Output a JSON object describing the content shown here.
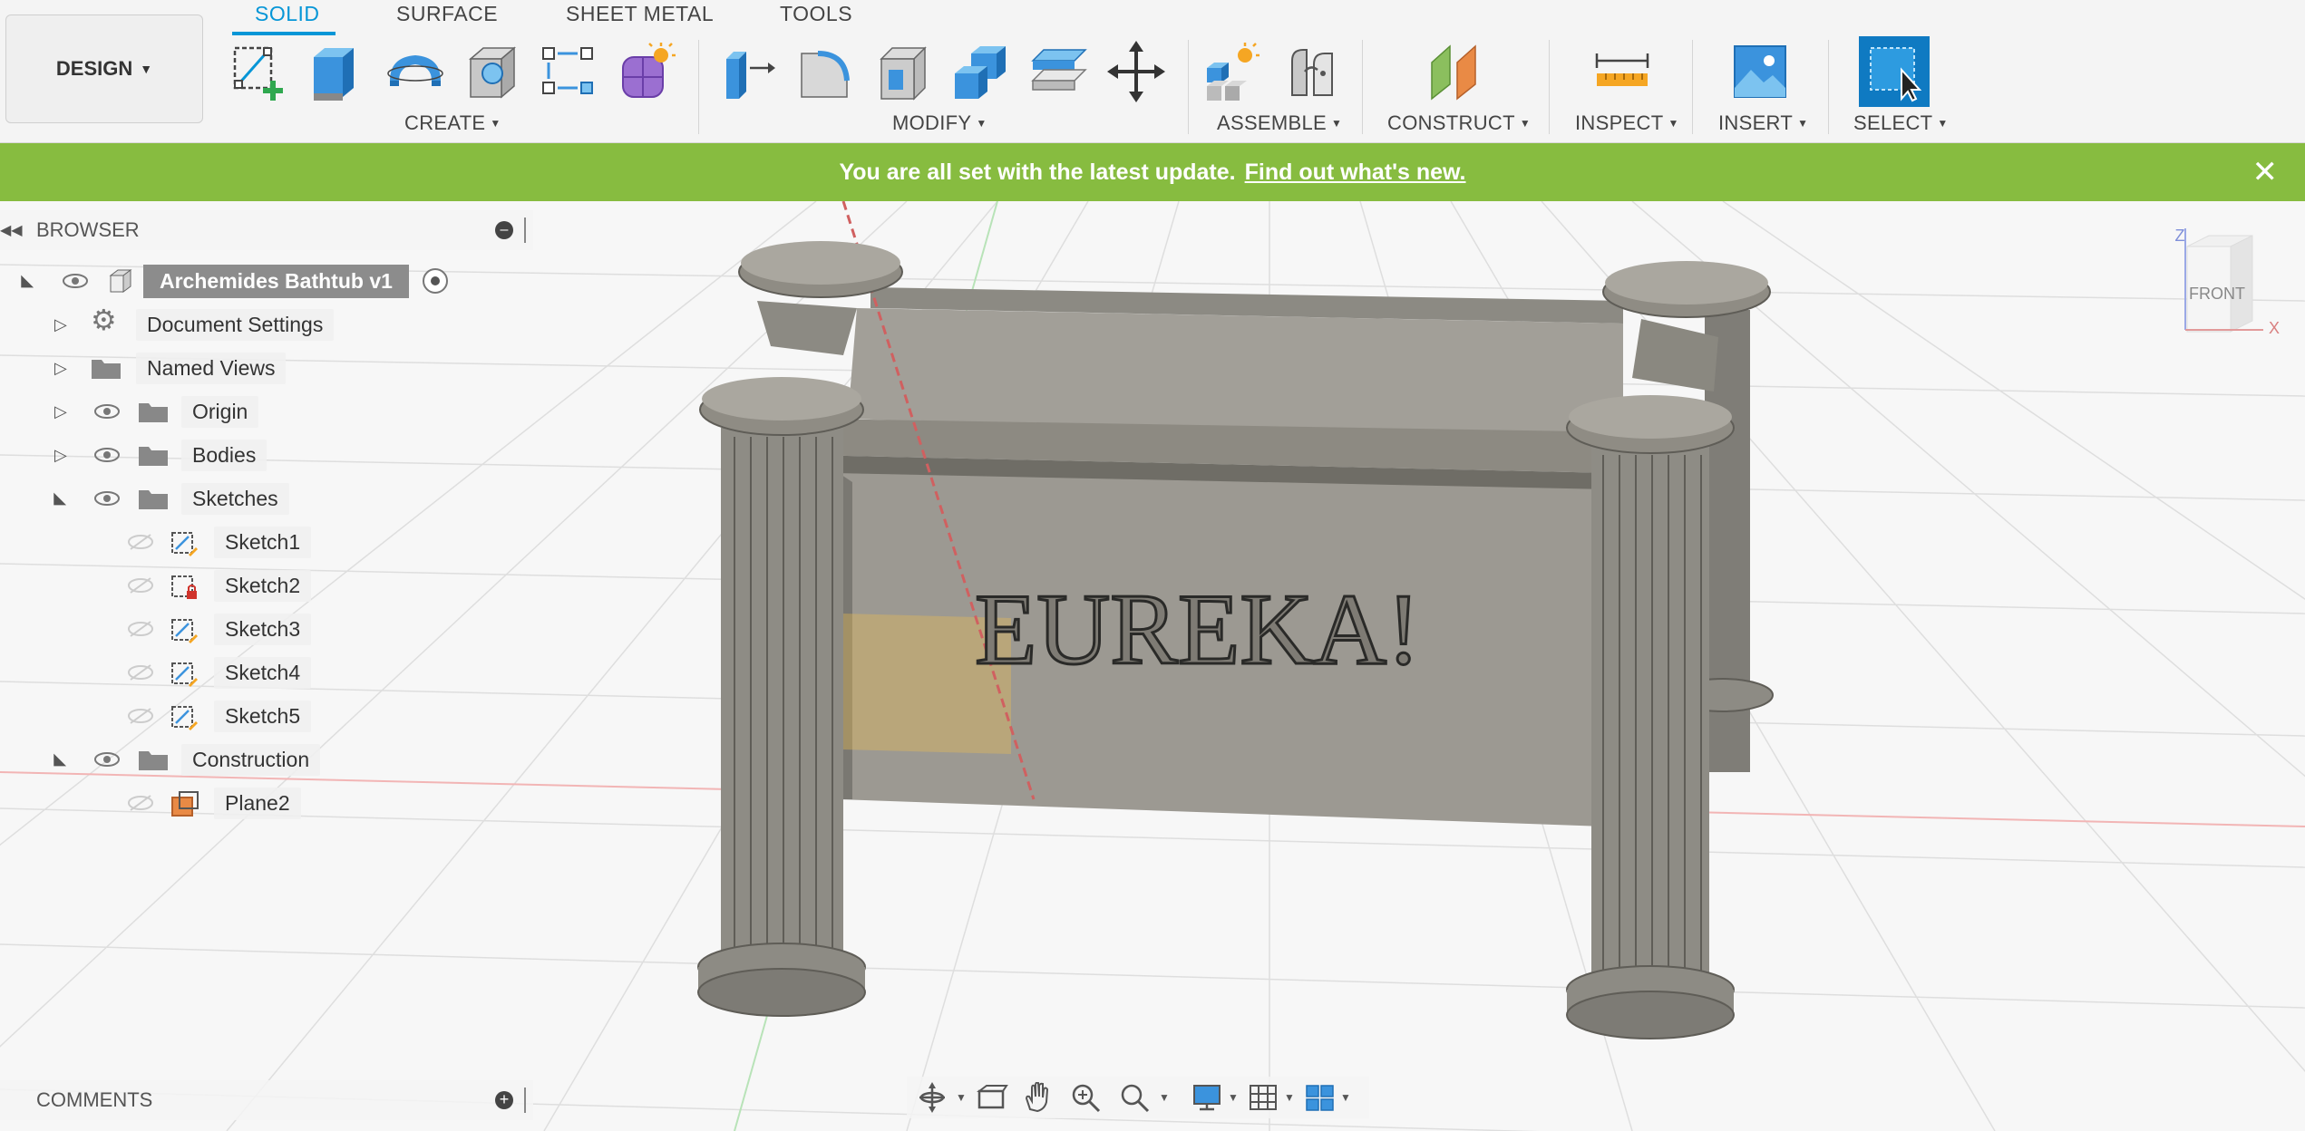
{
  "toolbar": {
    "workspace": "DESIGN",
    "tabs": [
      {
        "label": "SOLID",
        "active": true
      },
      {
        "label": "SURFACE",
        "active": false
      },
      {
        "label": "SHEET METAL",
        "active": false
      },
      {
        "label": "TOOLS",
        "active": false
      }
    ],
    "groups": {
      "create": "CREATE",
      "modify": "MODIFY",
      "assemble": "ASSEMBLE",
      "construct": "CONSTRUCT",
      "inspect": "INSPECT",
      "insert": "INSERT",
      "select": "SELECT"
    },
    "accent_color": "#0696d7"
  },
  "banner": {
    "message": "You are all set with the latest update.",
    "link": "Find out what's new.",
    "color": "#87bc40"
  },
  "browser": {
    "title": "BROWSER",
    "root": "Archemides Bathtub v1",
    "items": [
      {
        "label": "Document Settings",
        "icon": "gear-icon"
      },
      {
        "label": "Named Views",
        "icon": "folder-icon"
      },
      {
        "label": "Origin",
        "icon": "folder-icon"
      },
      {
        "label": "Bodies",
        "icon": "folder-icon"
      },
      {
        "label": "Sketches",
        "icon": "folder-icon",
        "expanded": true
      },
      {
        "label": "Sketch1",
        "icon": "sketch-icon"
      },
      {
        "label": "Sketch2",
        "icon": "sketch-locked-icon"
      },
      {
        "label": "Sketch3",
        "icon": "sketch-icon"
      },
      {
        "label": "Sketch4",
        "icon": "sketch-icon"
      },
      {
        "label": "Sketch5",
        "icon": "sketch-icon"
      },
      {
        "label": "Construction",
        "icon": "folder-icon",
        "expanded": true
      },
      {
        "label": "Plane2",
        "icon": "plane-icon"
      }
    ]
  },
  "comments": {
    "title": "COMMENTS"
  },
  "viewcube": {
    "face": "FRONT",
    "axis_z": "Z",
    "axis_x": "X"
  },
  "model": {
    "engraving": "EUREKA!"
  }
}
